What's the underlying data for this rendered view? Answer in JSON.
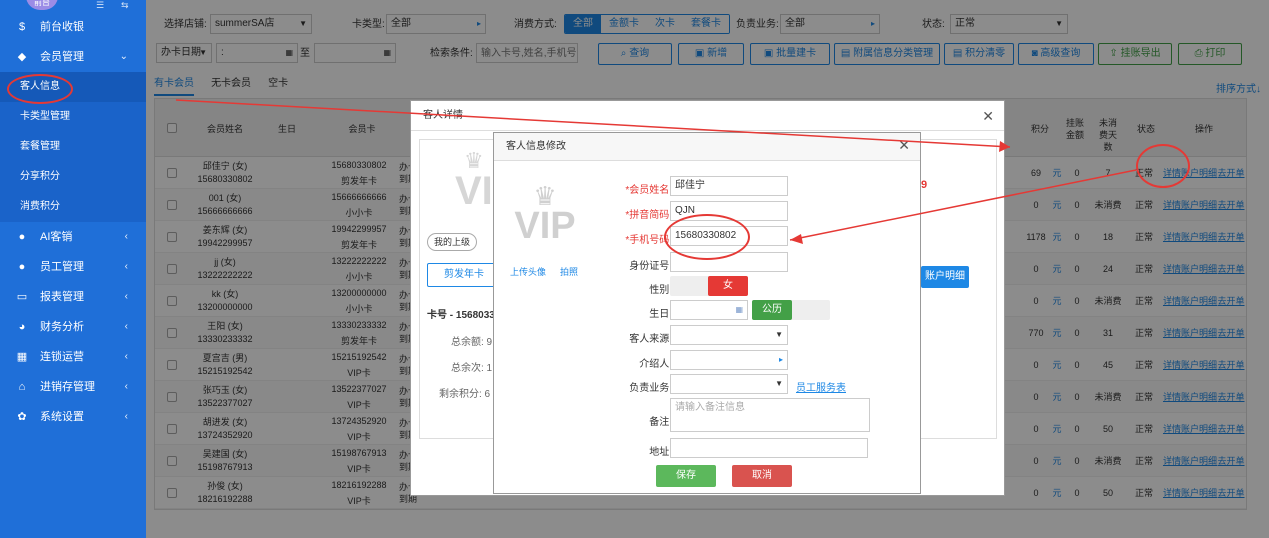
{
  "sidebar": {
    "badge": "前台",
    "items": [
      {
        "label": "前台收银",
        "icon": "dollar-icon"
      },
      {
        "label": "会员管理",
        "icon": "diamond-icon"
      },
      {
        "label": "AI客销",
        "icon": "user-icon"
      },
      {
        "label": "员工管理",
        "icon": "user-icon"
      },
      {
        "label": "报表管理",
        "icon": "monitor-icon"
      },
      {
        "label": "财务分析",
        "icon": "pie-icon"
      },
      {
        "label": "连锁运营",
        "icon": "building-icon"
      },
      {
        "label": "进销存管理",
        "icon": "home-icon"
      },
      {
        "label": "系统设置",
        "icon": "gear-icon"
      }
    ],
    "subitems": [
      "客人信息",
      "卡类型管理",
      "套餐管理",
      "分享积分",
      "消费积分"
    ]
  },
  "filters": {
    "store_label": "选择店铺:",
    "store_value": "summerSA店",
    "cardtype_label": "卡类型:",
    "cardtype_value": "全部",
    "pay_label": "消费方式:",
    "pay_options": [
      "全部",
      "金额卡",
      "次卡",
      "套餐卡"
    ],
    "owner_label": "负责业务:",
    "owner_value": "全部",
    "status_label": "状态:",
    "status_value": "正常",
    "date_type": "办卡日期",
    "date_sep": "至",
    "search_label": "检索条件:",
    "search_placeholder": "输入卡号,姓名,手机号"
  },
  "toolbar": {
    "query": "查询",
    "add": "新增",
    "batch": "批量建卡",
    "attach": "附属信息分类管理",
    "clear": "积分清零",
    "advanced": "高级查询",
    "export": "挂账导出",
    "print": "打印"
  },
  "tabs": [
    "有卡会员",
    "无卡会员",
    "空卡"
  ],
  "sort_label": "排序方式",
  "table": {
    "headers": {
      "name": "会员姓名",
      "birthday": "生日",
      "card": "会员卡",
      "points": "积分",
      "credit": "挂账金额",
      "unused": "未消费天数",
      "status": "状态",
      "ops": "操作"
    },
    "op_links": [
      "详情",
      "账户明细",
      "去开单"
    ],
    "rows": [
      {
        "name": "邱佳宁 (女)",
        "phone": "15680330802",
        "card": "15680330802",
        "ctype": "剪发年卡",
        "c1": "办卡",
        "c2": "到期",
        "points": "69",
        "credit": "0",
        "unused": "7",
        "status": "正常"
      },
      {
        "name": "001 (女)",
        "phone": "15666666666",
        "card": "15666666666",
        "ctype": "小小卡",
        "c1": "办卡",
        "c2": "到期",
        "points": "0",
        "credit": "0",
        "unused": "未消费",
        "status": "正常"
      },
      {
        "name": "姜东辉 (女)",
        "phone": "19942299957",
        "card": "19942299957",
        "ctype": "剪发年卡",
        "c1": "办卡",
        "c2": "到期",
        "points": "1178",
        "credit": "0",
        "unused": "18",
        "status": "正常"
      },
      {
        "name": "jj (女)",
        "phone": "13222222222",
        "card": "13222222222",
        "ctype": "小小卡",
        "c1": "办卡",
        "c2": "到期",
        "points": "0",
        "credit": "0",
        "unused": "24",
        "status": "正常"
      },
      {
        "name": "kk (女)",
        "phone": "13200000000",
        "card": "13200000000",
        "ctype": "小小卡",
        "c1": "办卡",
        "c2": "到期",
        "points": "0",
        "credit": "0",
        "unused": "未消费",
        "status": "正常"
      },
      {
        "name": "王阳 (女)",
        "phone": "13330233332",
        "card": "13330233332",
        "ctype": "剪发年卡",
        "c1": "办卡",
        "c2": "到期",
        "points": "770",
        "credit": "0",
        "unused": "31",
        "status": "正常"
      },
      {
        "name": "夏宫吉 (男)",
        "phone": "15215192542",
        "card": "15215192542",
        "ctype": "VIP卡",
        "c1": "办卡",
        "c2": "到期",
        "points": "0",
        "credit": "0",
        "unused": "45",
        "status": "正常"
      },
      {
        "name": "张巧玉 (女)",
        "phone": "13522377027",
        "card": "13522377027",
        "ctype": "VIP卡",
        "c1": "办卡",
        "c2": "到期",
        "points": "0",
        "credit": "0",
        "unused": "未消费",
        "status": "正常"
      },
      {
        "name": "胡进发 (女)",
        "phone": "13724352920",
        "card": "13724352920",
        "ctype": "VIP卡",
        "c1": "办卡",
        "c2": "到期",
        "points": "0",
        "credit": "0",
        "unused": "50",
        "status": "正常"
      },
      {
        "name": "吴建国 (女)",
        "phone": "15198767913",
        "card": "15198767913",
        "ctype": "VIP卡",
        "c1": "办卡",
        "c2": "到期",
        "points": "0",
        "credit": "0",
        "unused": "未消费",
        "status": "正常"
      },
      {
        "name": "孙俊 (女)",
        "phone": "18216192288",
        "card": "18216192288",
        "ctype": "VIP卡",
        "c1": "办卡",
        "c2": "到期",
        "points": "0",
        "credit": "0",
        "unused": "50",
        "status": "正常"
      }
    ]
  },
  "detail_modal": {
    "title": "客人详情",
    "my_superior": "我的上级",
    "haircut_card": "剪发年卡",
    "account_detail": "账户明细",
    "card_no": "卡号 - 1568033",
    "balance": "总余额: 9",
    "times": "总余次: 1",
    "points": "剩余积分: 6",
    "red_digit": "9",
    "vip_text": "VI"
  },
  "edit_modal": {
    "title": "客人信息修改",
    "vip_text": "VIP",
    "upload": "上传头像",
    "photo": "拍照",
    "name_label": "*会员姓名:",
    "name_value": "邱佳宁",
    "py_label": "*拼音简码:",
    "py_value": "QJN",
    "phone_label": "*手机号码:",
    "phone_value": "15680330802",
    "id_label": "身份证号:",
    "gender_label": "性别:",
    "gender_value": "女",
    "birthday_label": "生日:",
    "calendar_type": "公历",
    "source_label": "客人来源:",
    "referrer_label": "介绍人:",
    "owner_label": "负责业务:",
    "staff_link": "员工服务表",
    "note_label": "备注:",
    "note_placeholder": "请输入备注信息",
    "address_label": "地址:",
    "save": "保存",
    "cancel": "取消"
  }
}
